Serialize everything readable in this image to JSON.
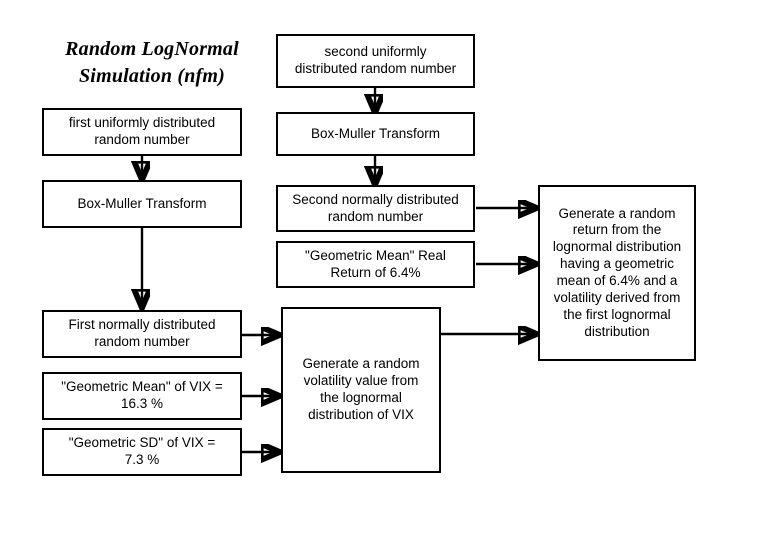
{
  "diagram": {
    "title": "Random LogNormal\nSimulation    (nfm)",
    "background_color": "#ffffff",
    "line_color": "#000000",
    "text_color": "#000000",
    "nodes": {
      "first_uniform": "first uniformly distributed\nrandom number",
      "box_muller_left": "Box-Muller Transform",
      "first_normal": "First normally distributed\nrandom number",
      "geo_mean_vix": "\"Geometric Mean\" of VIX =\n16.3 %",
      "geo_sd_vix": "\"Geometric SD\" of VIX =\n7.3 %",
      "second_uniform": "second uniformly\ndistributed random number",
      "box_muller_mid": "Box-Muller Transform",
      "second_normal": "Second normally distributed\nrandom number",
      "geo_mean_real": "\"Geometric Mean\" Real\nReturn of 6.4%",
      "generate_volatility": "Generate a random\nvolatility value from\nthe lognormal\ndistribution of VIX",
      "generate_return": "Generate a random\nreturn from the\nlognormal distribution\nhaving a geometric\nmean of 6.4% and a\nvolatility derived from\nthe first lognormal\ndistribution"
    }
  }
}
